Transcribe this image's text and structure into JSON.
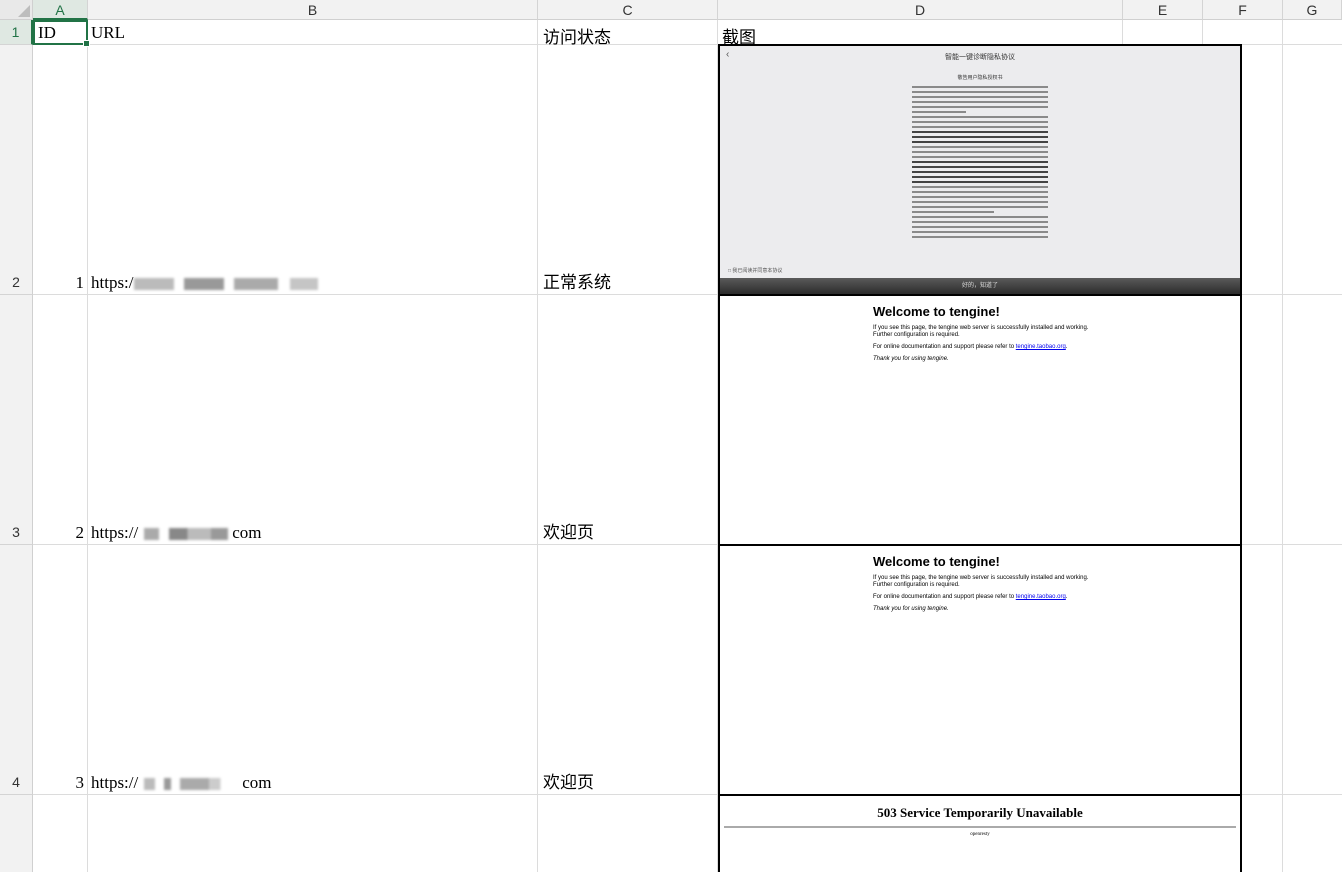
{
  "columns": [
    "A",
    "B",
    "C",
    "D",
    "E",
    "F",
    "G"
  ],
  "rows": [
    "1",
    "2",
    "3",
    "4"
  ],
  "header": {
    "id": "ID",
    "url": "URL",
    "status": "访问状态",
    "screenshot": "截图"
  },
  "records": [
    {
      "id": "1",
      "url_prefix": "https:/",
      "status": "正常系统"
    },
    {
      "id": "2",
      "url_prefix": "https://",
      "url_suffix": "com",
      "status": "欢迎页"
    },
    {
      "id": "3",
      "url_prefix": "https://",
      "url_suffix": "com",
      "status": "欢迎页"
    }
  ],
  "shot1": {
    "title": "智能一键诊断隐私协议",
    "subtitle": "敬告用户隐私授权书",
    "checkbox": "我已阅读并同意本协议",
    "button": "好的，知道了"
  },
  "tengine": {
    "heading": "Welcome to tengine!",
    "para1": "If you see this page, the tengine web server is successfully installed and working. Further configuration is required.",
    "para2_prefix": "For online documentation and support please refer to ",
    "link": "tengine.taobao.org",
    "thanks": "Thank you for using tengine."
  },
  "error503": {
    "title": "503 Service Temporarily Unavailable",
    "server": "openresty"
  },
  "colors": {
    "selection": "#217346",
    "grid": "#dcdcdc",
    "header_bg": "#f2f2f2"
  }
}
